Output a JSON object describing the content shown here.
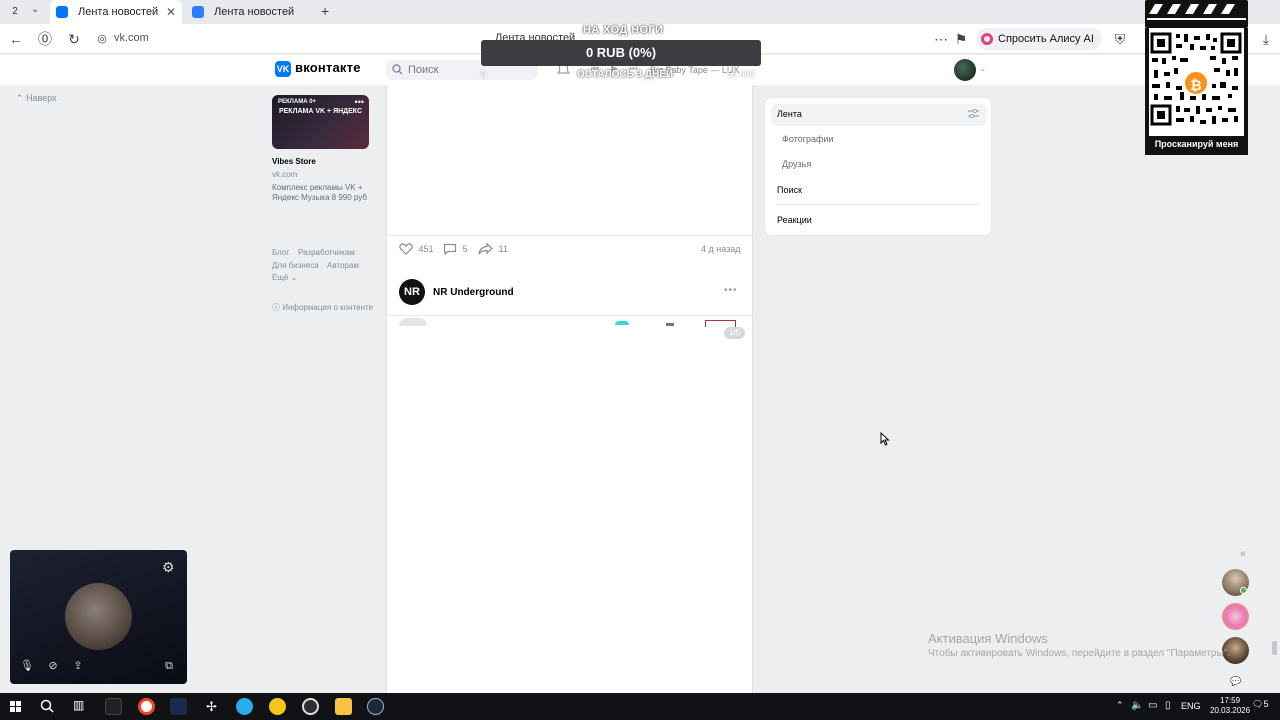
{
  "browser": {
    "tab_count": "2",
    "tabs": [
      {
        "label": "Лента новостей",
        "active": true
      },
      {
        "label": "Лента новостей",
        "active": false
      }
    ],
    "url": "vk.com",
    "page_title": "Лента новостей",
    "alice_label": "Спросить Алису AI"
  },
  "stream_overlay": {
    "donate_title": "НА ХОД НОГИ",
    "donate_value": "0 RUB (0%)",
    "donate_caption": "ОСТАЛОСЬ 3 ДНЕЙ",
    "donate_min": "0",
    "donate_max": "50 000",
    "qr_label": "Просканируй меня"
  },
  "vk": {
    "logo_text": "вконтакте",
    "search_placeholder": "Поиск",
    "player_track": "Big Baby Tape — LUX",
    "back_to_top": "Наверх",
    "ad": {
      "badge": "РЕКЛАМА 0+",
      "headline": "РЕКЛАМА VK + ЯНДЕКС",
      "title": "Vibes Store",
      "domain": "vk.com",
      "description": "Комплекс рекламы VK + Яндекс Музыка 8 990 руб"
    },
    "footer_links": [
      "Блог",
      "Разработчикам",
      "Для бизнеса",
      "Авторам",
      "Ещё"
    ],
    "info_content": "Информация о контенте",
    "post": {
      "likes": "451",
      "comments": "5",
      "shares": "11",
      "time": "4 д назад"
    },
    "next_post": {
      "author": "NR Underground",
      "avatar_text": "NR",
      "photo_counter": "1/5"
    },
    "right_menu": {
      "items": [
        "Лента",
        "Фотографии",
        "Друзья",
        "Поиск",
        "Реакции"
      ]
    }
  },
  "windows": {
    "activation_title": "Активация Windows",
    "activation_text": "Чтобы активировать Windows, перейдите в раздел \"Параметры\".",
    "lang": "ENG",
    "time": "17:59",
    "date": "20.03.2026",
    "notifications": "5"
  },
  "colors": {
    "vk_blue": "#0077ff",
    "alice_pink": "#e4407a",
    "bitcoin": "#f7931a",
    "online": "#4bb34b"
  }
}
